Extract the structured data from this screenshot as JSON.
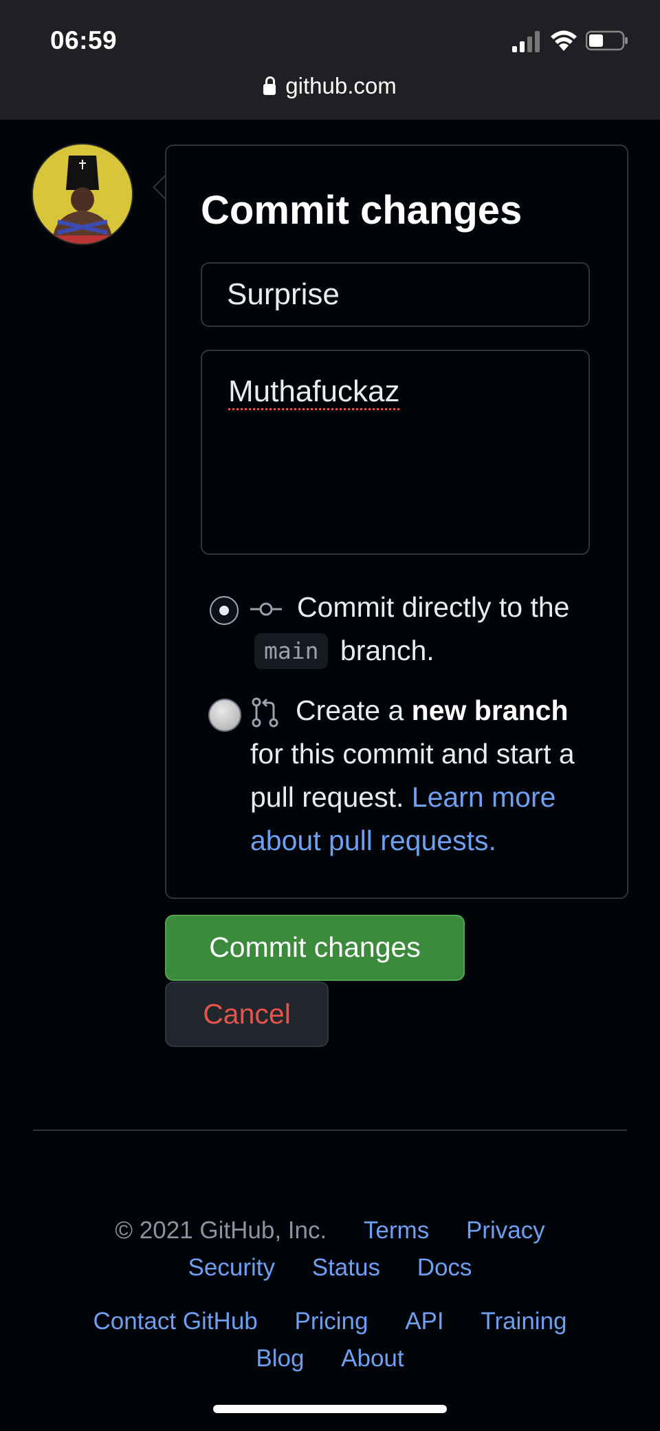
{
  "status_bar": {
    "time": "06:59",
    "url": "github.com"
  },
  "panel": {
    "title": "Commit changes",
    "summary_value": "Surprise",
    "description_value": "Muthafuckaz",
    "option_direct": {
      "text_before": "Commit directly to the",
      "branch": "main",
      "text_after": "branch.",
      "selected": true
    },
    "option_new_branch": {
      "text_before": "Create a",
      "bold": "new branch",
      "text_after": "for this commit and start a pull request.",
      "link": "Learn more about pull requests.",
      "selected": false
    }
  },
  "buttons": {
    "commit_label": "Commit changes",
    "cancel_label": "Cancel"
  },
  "footer": {
    "copyright": "© 2021 GitHub, Inc.",
    "row1_links": [
      "Terms",
      "Privacy"
    ],
    "row2_links": [
      "Security",
      "Status",
      "Docs"
    ],
    "row3_links": [
      "Contact GitHub",
      "Pricing",
      "API",
      "Training"
    ],
    "row4_links": [
      "Blog",
      "About"
    ]
  },
  "colors": {
    "commit_green": "#3c8b3c",
    "cancel_red": "#e5534b",
    "link_blue": "#6f9ff0"
  },
  "icons": [
    "lock-icon",
    "cellular-signal-icon",
    "wifi-icon",
    "battery-icon",
    "git-commit-icon",
    "git-pull-request-icon"
  ]
}
